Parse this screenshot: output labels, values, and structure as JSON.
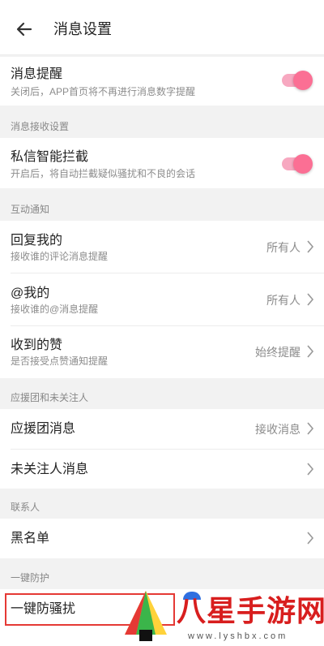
{
  "header": {
    "title": "消息设置",
    "back_icon": "arrow-left-icon"
  },
  "notify": {
    "label": "消息提醒",
    "desc": "关闭后，APP首页将不再进行消息数字提醒",
    "enabled": true
  },
  "sections": {
    "receive": "消息接收设置",
    "interaction": "互动通知",
    "support": "应援团和未关注人",
    "contacts": "联系人",
    "protect": "一键防护"
  },
  "dm_filter": {
    "label": "私信智能拦截",
    "desc": "开启后，将自动拦截疑似骚扰和不良的会话",
    "enabled": true
  },
  "reply": {
    "label": "回复我的",
    "desc": "接收谁的评论消息提醒",
    "value": "所有人"
  },
  "mention": {
    "label": "@我的",
    "desc": "接收谁的@消息提醒",
    "value": "所有人"
  },
  "likes": {
    "label": "收到的赞",
    "desc": "是否接受点赞通知提醒",
    "value": "始终提醒"
  },
  "support_msg": {
    "label": "应援团消息",
    "value": "接收消息"
  },
  "stranger_msg": {
    "label": "未关注人消息"
  },
  "blacklist": {
    "label": "黑名单"
  },
  "anti_harass": {
    "label": "一键防骚扰"
  },
  "watermark": {
    "text": "八星手游网",
    "url": "www.lyshbx.com"
  },
  "colors": {
    "accent": "#fb6f94",
    "track": "#f7a8c0",
    "highlight": "#e53935",
    "watermark": "#d81e1e"
  }
}
